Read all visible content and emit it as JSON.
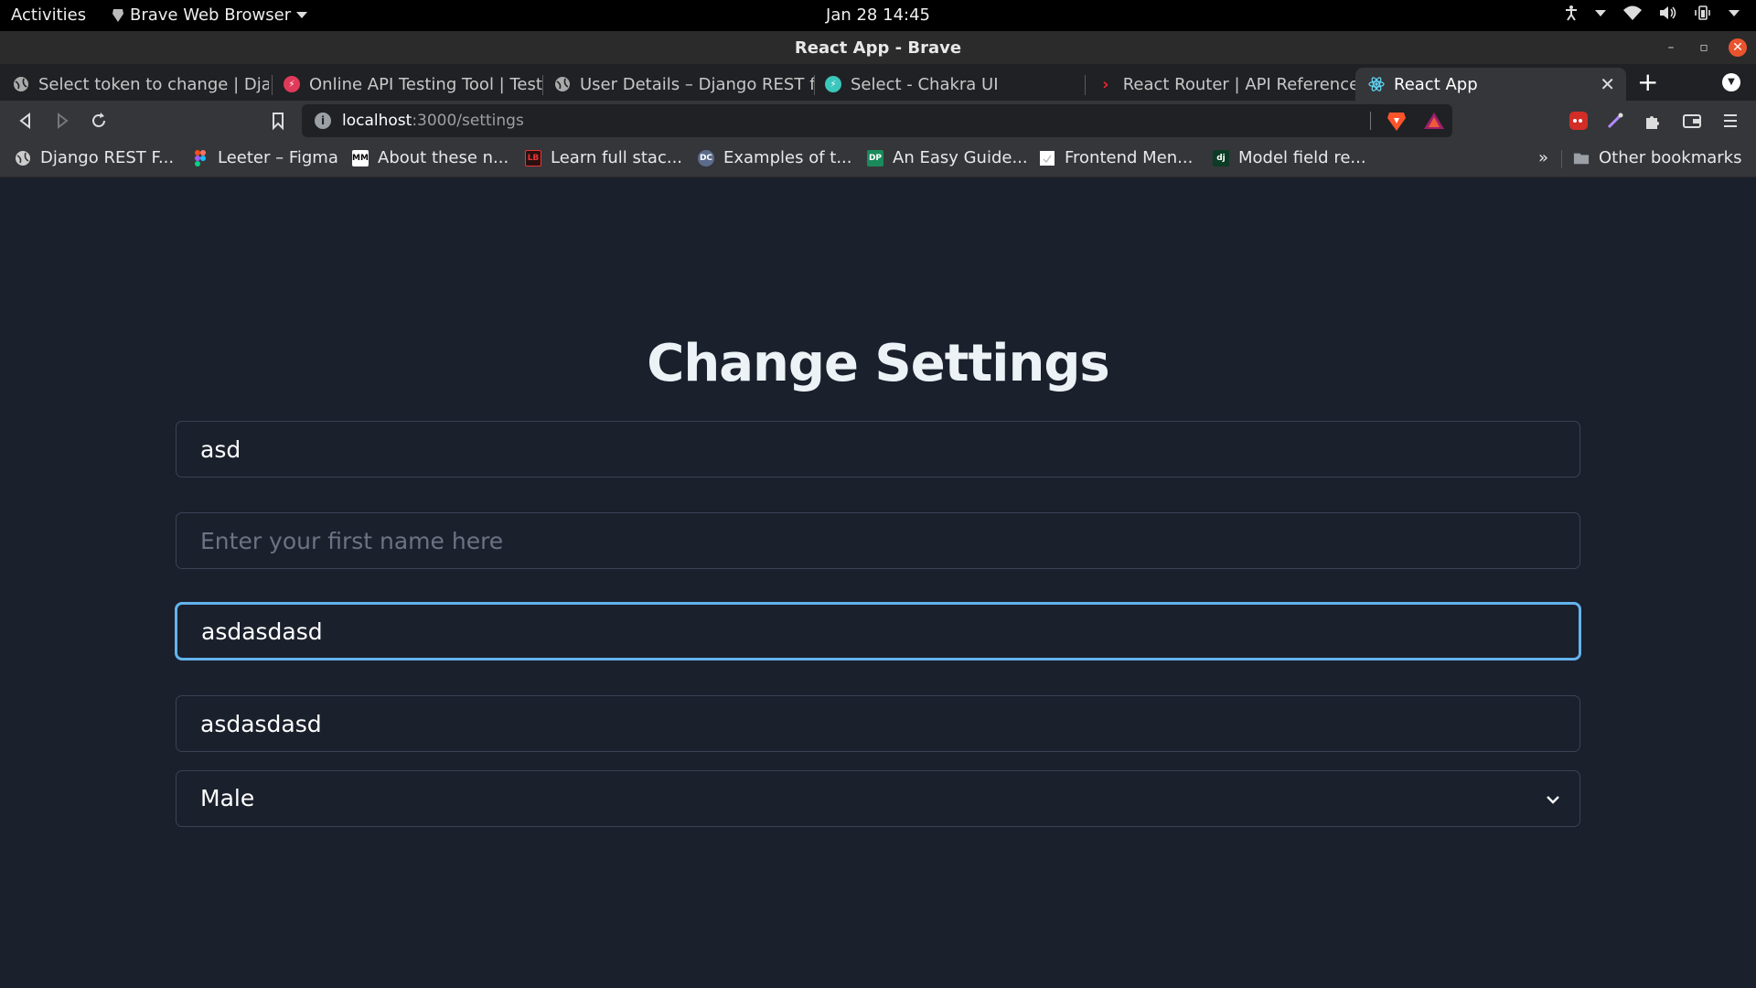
{
  "system_bar": {
    "activities": "Activities",
    "app_name": "Brave Web Browser",
    "clock": "Jan 28  14:45"
  },
  "window": {
    "title": "React App - Brave"
  },
  "tabs": [
    {
      "label": "Select token to change | Djan",
      "favicon": "globe-icon"
    },
    {
      "label": "Online API Testing Tool | Test",
      "favicon": "reqbin-icon"
    },
    {
      "label": "User Details – Django REST fr",
      "favicon": "globe-icon"
    },
    {
      "label": "Select - Chakra UI",
      "favicon": "chakra-icon"
    },
    {
      "label": "React Router | API Reference",
      "favicon": "react-router-icon"
    },
    {
      "label": "React App",
      "favicon": "react-icon",
      "active": true
    }
  ],
  "toolbar": {
    "url_host": "localhost",
    "url_path": ":3000/settings"
  },
  "bookmarks": [
    {
      "label": "Django REST F...",
      "icon": "globe-icon"
    },
    {
      "label": "Leeter – Figma",
      "icon": "figma-icon"
    },
    {
      "label": "About these n...",
      "icon": "MM"
    },
    {
      "label": "Learn full stac...",
      "icon": "LB"
    },
    {
      "label": "Examples of t...",
      "icon": "DC"
    },
    {
      "label": "An Easy Guide...",
      "icon": "DP"
    },
    {
      "label": "Frontend Men...",
      "icon": "page-icon"
    },
    {
      "label": "Model field re...",
      "icon": "dj"
    }
  ],
  "bookmarks_more": "»",
  "other_bookmarks": "Other bookmarks",
  "page": {
    "title": "Change Settings",
    "fields": [
      {
        "value": "asd",
        "placeholder": ""
      },
      {
        "value": "",
        "placeholder": "Enter your first name here"
      },
      {
        "value": "asdasdasd",
        "placeholder": ""
      },
      {
        "value": "asdasdasd",
        "placeholder": ""
      }
    ],
    "gender_select": {
      "selected": "Male"
    }
  },
  "colors": {
    "page_bg": "#1a202c",
    "focus_ring": "#63b3ed",
    "input_border": "#3a4354"
  }
}
